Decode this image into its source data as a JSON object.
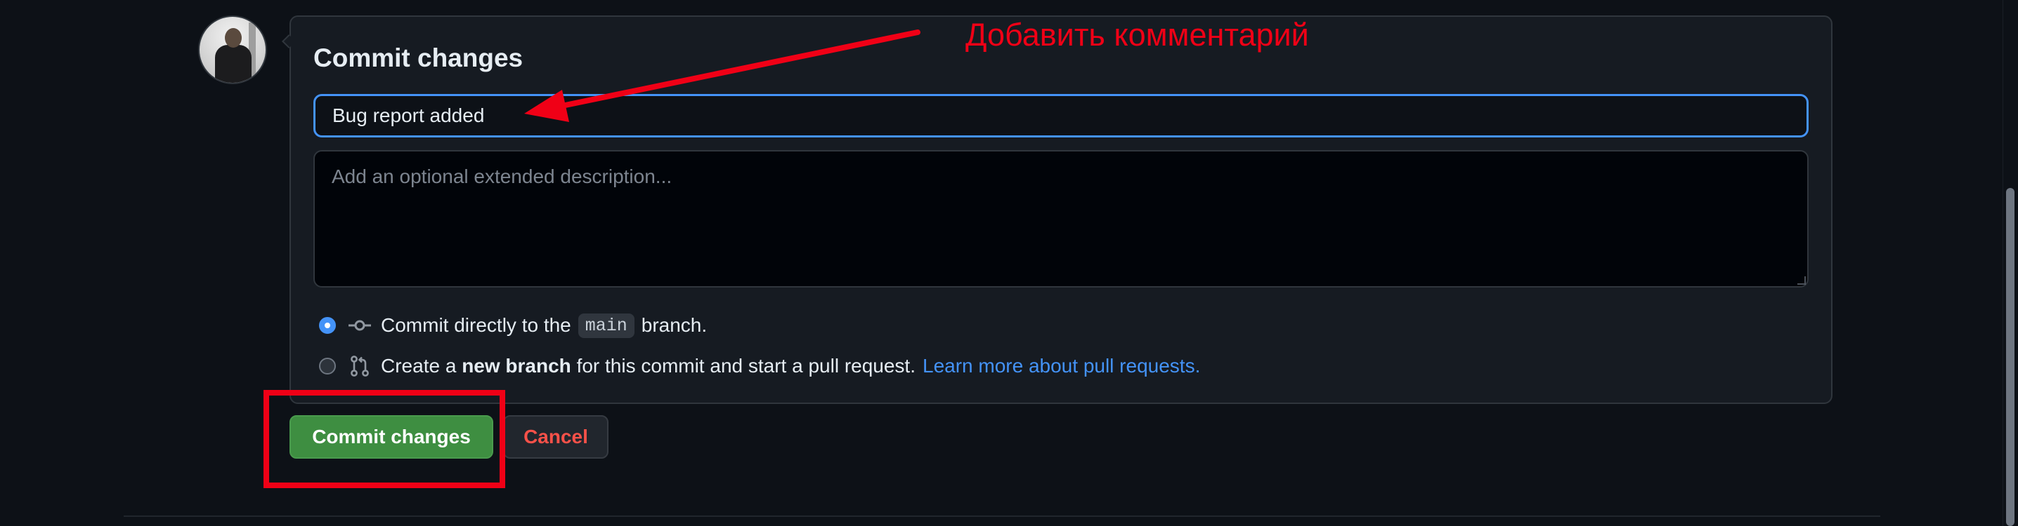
{
  "commit_form": {
    "title": "Commit changes",
    "summary_value": "Bug report added",
    "description_placeholder": "Add an optional extended description...",
    "option_direct": {
      "text_before": "Commit directly to the",
      "branch": "main",
      "text_after": "branch.",
      "selected": true
    },
    "option_new_branch": {
      "text_before": "Create a",
      "bold": "new branch",
      "text_after": "for this commit and start a pull request.",
      "link": "Learn more about pull requests.",
      "selected": false
    }
  },
  "actions": {
    "commit_label": "Commit changes",
    "cancel_label": "Cancel"
  },
  "annotation": {
    "text": "Добавить комментарий",
    "color": "#f00016"
  },
  "colors": {
    "background": "#0d1117",
    "panel": "#161b22",
    "accent": "#4493f8",
    "commit_button": "#3e8e41",
    "cancel_text": "#f85149"
  },
  "icons": {
    "commit": "git-commit-icon",
    "pull_request": "git-pull-request-icon"
  }
}
